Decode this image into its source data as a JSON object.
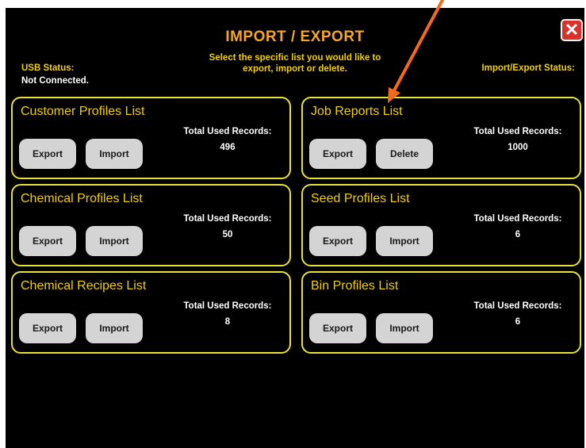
{
  "header": {
    "title": "IMPORT / EXPORT",
    "subtitle": "Select the specific list you would like to\nexport, import or delete.",
    "usb_status_label": "USB Status:",
    "usb_status_value": "Not Connected.",
    "import_export_status_label": "Import/Export Status:",
    "close_icon": "close-icon",
    "close_color": "#d9322b"
  },
  "panels": [
    {
      "title": "Customer Profiles List",
      "records_label": "Total Used Records:",
      "records": "496",
      "buttons": [
        "Export",
        "Import"
      ]
    },
    {
      "title": "Job Reports List",
      "records_label": "Total Used Records:",
      "records": "1000",
      "buttons": [
        "Export",
        "Delete"
      ]
    },
    {
      "title": "Chemical Profiles List",
      "records_label": "Total Used Records:",
      "records": "50",
      "buttons": [
        "Export",
        "Import"
      ]
    },
    {
      "title": "Seed Profiles List",
      "records_label": "Total Used Records:",
      "records": "6",
      "buttons": [
        "Export",
        "Import"
      ]
    },
    {
      "title": "Chemical Recipes List",
      "records_label": "Total Used Records:",
      "records": "8",
      "buttons": [
        "Export",
        "Import"
      ]
    },
    {
      "title": "Bin Profiles List",
      "records_label": "Total Used Records:",
      "records": "6",
      "buttons": [
        "Export",
        "Import"
      ]
    }
  ],
  "colors": {
    "background": "#000000",
    "title": "#f5a623",
    "accent_text": "#f0d000",
    "panel_border": "#e8e330",
    "button": "#d4d4d4",
    "annotation_arrow": "#f26b1d"
  }
}
